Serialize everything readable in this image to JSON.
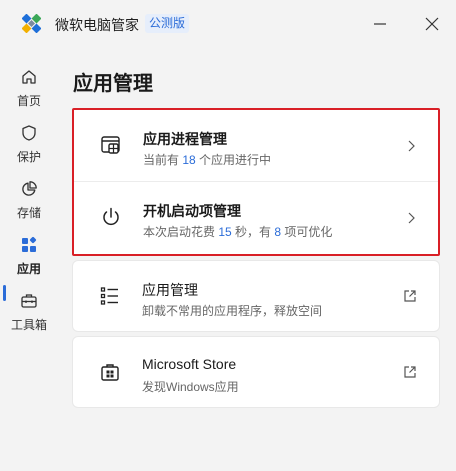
{
  "app": {
    "title": "微软电脑管家",
    "badge": "公测版"
  },
  "sidebar": {
    "items": [
      {
        "label": "首页",
        "icon": "home-icon"
      },
      {
        "label": "保护",
        "icon": "shield-icon"
      },
      {
        "label": "存储",
        "icon": "pie-chart-icon"
      },
      {
        "label": "应用",
        "icon": "apps-icon",
        "active": true
      },
      {
        "label": "工具箱",
        "icon": "toolbox-icon"
      }
    ],
    "accent": "#2b6cd8"
  },
  "main": {
    "title": "应用管理",
    "rows": [
      {
        "title": "应用进程管理",
        "sub_pre": "当前有 ",
        "sub_num": "18",
        "sub_post": " 个应用进行中"
      },
      {
        "title": "开机启动项管理",
        "sub_pre": "本次启动花费 ",
        "sub_num": "15",
        "sub_mid": " 秒，有 ",
        "sub_num2": "8",
        "sub_post": " 项可优化"
      },
      {
        "title": "应用管理",
        "sub": "卸载不常用的应用程序，释放空间"
      },
      {
        "title": "Microsoft Store",
        "sub": "发现Windows应用"
      }
    ],
    "highlight_color": "#d91f26"
  }
}
